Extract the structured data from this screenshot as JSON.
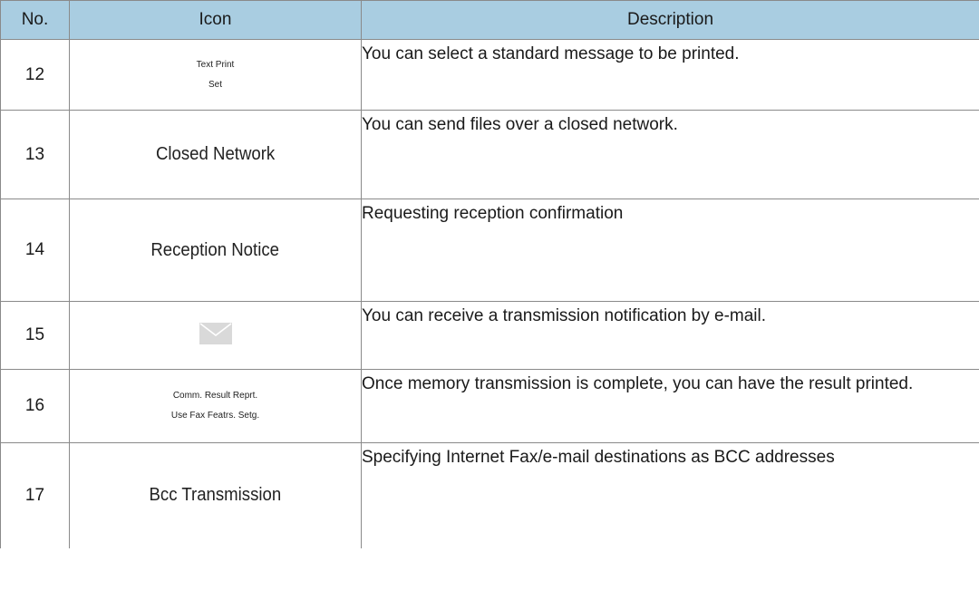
{
  "table": {
    "headers": {
      "no": "No.",
      "icon": "Icon",
      "description": "Description"
    },
    "rows": [
      {
        "no": "12",
        "icon_lines": [
          "Text Print",
          "Set"
        ],
        "description": "You can select a standard message to be printed."
      },
      {
        "no": "13",
        "icon_text": "Closed Network",
        "description": "You can send files over a closed network."
      },
      {
        "no": "14",
        "icon_text": "Reception Notice",
        "description": "Requesting reception confirmation"
      },
      {
        "no": "15",
        "icon_name": "envelope-icon",
        "description": "You can receive a transmission notification by e-mail."
      },
      {
        "no": "16",
        "icon_lines": [
          "Comm. Result Reprt.",
          "Use Fax Featrs. Setg."
        ],
        "description": "Once memory transmission is complete, you can have the result printed."
      },
      {
        "no": "17",
        "icon_text": "Bcc Transmission",
        "description": "Specifying Internet Fax/e-mail destinations as BCC addresses"
      }
    ]
  },
  "colors": {
    "header_bg": "#a9cde1",
    "border": "#8a8a8a",
    "icon_gray": "#d9d9d9"
  }
}
